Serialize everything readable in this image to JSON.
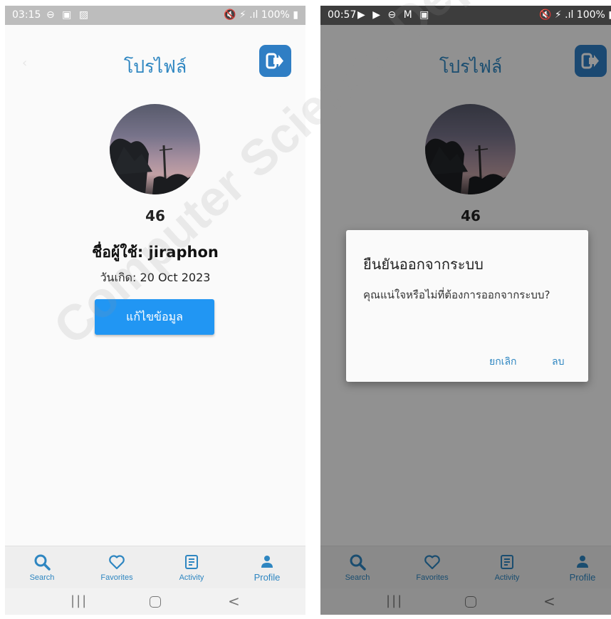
{
  "left_screen": {
    "status_bar": {
      "time": "03:15",
      "icons_left": "⊖ ▣ ▨",
      "icons_right": "🔇 ⚡ .ıl 100% ▮"
    },
    "header": {
      "title": "โปรไฟล์",
      "back_icon": "back-arrow-icon",
      "logout_icon": "logout-icon"
    },
    "profile": {
      "user_id": "46",
      "username": "ชื่อผู้ใช้: jiraphon",
      "birthdate": "วันเกิด: 20 Oct 2023",
      "edit_button": "แก้ไขข้อมูล"
    },
    "bottom_nav": [
      {
        "label": "Search",
        "icon": "search-icon"
      },
      {
        "label": "Favorites",
        "icon": "heart-icon"
      },
      {
        "label": "Activity",
        "icon": "document-icon"
      },
      {
        "label": "Profile",
        "icon": "person-icon"
      }
    ]
  },
  "right_screen": {
    "status_bar": {
      "time": "00:57",
      "icons_left": "▶ ▶ ⊖ M ▣",
      "icons_right": "🔇 ⚡ .ıl 100% ▮"
    },
    "header": {
      "title": "โปรไฟล์"
    },
    "profile": {
      "user_id": "46"
    },
    "dialog": {
      "title": "ยืนยันออกจากระบบ",
      "message": "คุณแน่ใจหรือไม่ที่ต้องการออกจากระบบ?",
      "cancel_label": "ยกเลิก",
      "confirm_label": "ลบ"
    },
    "bottom_nav": [
      {
        "label": "Search",
        "icon": "search-icon"
      },
      {
        "label": "Favorites",
        "icon": "heart-icon"
      },
      {
        "label": "Activity",
        "icon": "document-icon"
      },
      {
        "label": "Profile",
        "icon": "person-icon"
      }
    ]
  },
  "system_nav": {
    "recent": "|||",
    "back": "<"
  },
  "watermark_text": "Computer Science Department Mahasarakham University",
  "colors": {
    "accent": "#2e86c1",
    "button": "#2196f3",
    "logout_bg": "#2f7ec4",
    "background": "#fafafa"
  }
}
